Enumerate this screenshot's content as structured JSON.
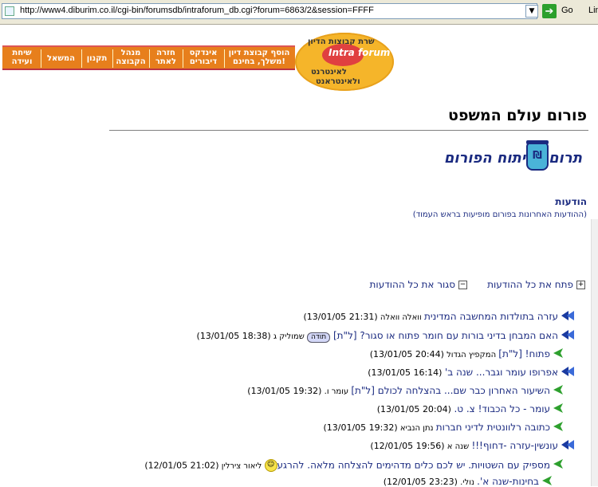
{
  "browser": {
    "url": "http://www4.diburim.co.il/cgi-bin/forumsdb/intraforum_db.cgi?forum=6863/2&session=FFFF",
    "go_label": "Go",
    "links_label": "Lin"
  },
  "nav": {
    "items": [
      "שיחת ועידה",
      "המשאל",
      "תקנון",
      "מנהל הקבוצה",
      "חזרה לאתר",
      "אינדקס דיבורים",
      "הוסף קבוצת דיון משלך, בחינם!"
    ]
  },
  "logo": {
    "top_line": "שרת קבוצות הדיון",
    "brand": "Intra forum",
    "line2": "לאינטרנט",
    "line3": "ולאינטראנט"
  },
  "page": {
    "title": "פורום עולם המשפט",
    "donate_text": "תרום לפיתוח הפורום",
    "donate_icon_glyph": "₪",
    "announcements_title": "הודעות",
    "announcements_sub": "(ההודעות האחרונות בפורום מופיעות בראש העמוד)",
    "expand_all": "פתח את כל ההודעות",
    "collapse_all": "סגור את כל ההודעות"
  },
  "messages": [
    {
      "subject": "עזרה בתולדות המחשבה המדינית",
      "author": "וואלה וואלה",
      "time": "(21:31 13/01/05)",
      "arrow": "blue",
      "tag": ""
    },
    {
      "subject": "האם המבחן בדיני בורות עם חומר פתוח או סגור?",
      "author": "שמוליק ג",
      "time": "(18:38 13/01/05)",
      "arrow": "blue",
      "tag": "[ל\"ת]",
      "badge": "תודה"
    },
    {
      "subject": "פתוח! [ל\"ת]",
      "author": "המקפיץ הגדול",
      "time": "(20:44 13/01/05)",
      "arrow": "green",
      "tag": ""
    },
    {
      "subject": "אפרופו עומר וגבר... שנה ב'",
      "author": "",
      "time": "(16:14 13/01/05)",
      "arrow": "blue",
      "tag": ""
    },
    {
      "subject": "השיעור האחרון כבר שם... בהצלחה לכולם [ל\"ת]",
      "author": "עומר ו.",
      "time": "(19:32 13/01/05)",
      "arrow": "green",
      "tag": ""
    },
    {
      "subject": "עומר - כל הכבוד! צ. ט.",
      "author": "",
      "time": "(20:04 13/01/05)",
      "arrow": "green",
      "tag": ""
    },
    {
      "subject": "כתובה רלוונטית לדיני חברות",
      "author": "נתן הנביא",
      "time": "(19:32 13/01/05)",
      "arrow": "green",
      "tag": ""
    },
    {
      "subject": "עונשין-עזרה -דחוף!!!",
      "author": "שנה א",
      "time": "(19:56 12/01/05)",
      "arrow": "blue",
      "tag": ""
    },
    {
      "subject": "מספיק עם השטויות. יש לכם כלים מדהימים להצלחה מלאה. להרגע",
      "author": "ליאור צירלין",
      "time": "(21:02 12/01/05)",
      "arrow": "green",
      "tag": "",
      "smiley": true
    },
    {
      "subject": "בחינות-שנה א'.",
      "author": "נולי.",
      "time": "(23:23 12/01/05)",
      "arrow": "green",
      "tag": ""
    }
  ]
}
